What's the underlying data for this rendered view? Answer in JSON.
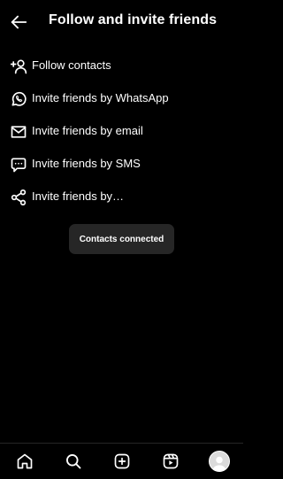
{
  "header": {
    "title": "Follow and invite friends",
    "back_icon": "arrow-left-icon"
  },
  "menu": {
    "items": [
      {
        "label": "Follow contacts",
        "icon": "add-person-icon"
      },
      {
        "label": "Invite friends by WhatsApp",
        "icon": "whatsapp-icon"
      },
      {
        "label": "Invite friends by email",
        "icon": "email-icon"
      },
      {
        "label": "Invite friends by SMS",
        "icon": "sms-icon"
      },
      {
        "label": "Invite friends by…",
        "icon": "share-icon"
      }
    ]
  },
  "toast": {
    "text": "Contacts connected"
  },
  "navbar": {
    "items": [
      "home-icon",
      "search-icon",
      "create-icon",
      "reels-icon",
      "profile-avatar"
    ]
  },
  "colors": {
    "background": "#000000",
    "text": "#ffffff",
    "toast_bg": "#262626"
  }
}
